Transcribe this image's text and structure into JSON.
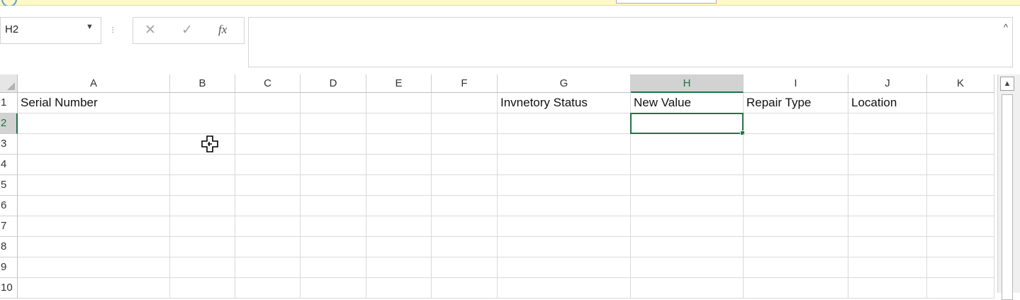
{
  "formula_bar": {
    "name_box": "H2",
    "separator": "⁝",
    "cancel_icon": "✕",
    "enter_icon": "✓",
    "function_label": "fx",
    "formula_value": "",
    "collapse_icon": "^"
  },
  "sheet": {
    "columns": [
      "A",
      "B",
      "C",
      "D",
      "E",
      "F",
      "G",
      "H",
      "I",
      "J",
      "K"
    ],
    "rows": [
      "1",
      "2",
      "3",
      "4",
      "5",
      "6",
      "7",
      "8",
      "9",
      "10"
    ],
    "selected_cell": "H2",
    "selected_column": "H",
    "selected_row": "2",
    "headers": {
      "A1": "Serial Number",
      "G1": "Invnetory Status",
      "H1": "New Value",
      "I1": "Repair Type",
      "J1": "Location"
    }
  },
  "scrollbar": {
    "up_arrow": "▲"
  },
  "colors": {
    "accent": "#217346",
    "selected_header_bg": "#d2d2d2",
    "gridline": "#dadada",
    "notification_bar": "#fff8c7"
  }
}
